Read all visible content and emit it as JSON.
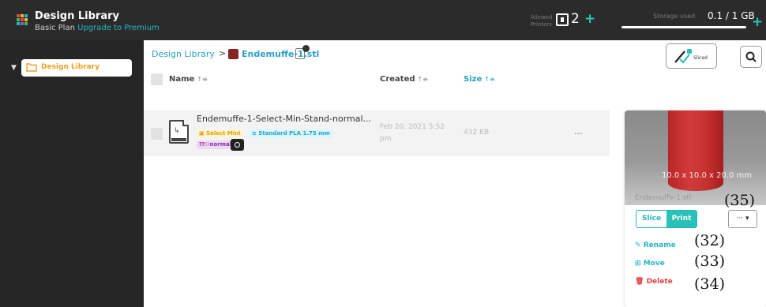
{
  "header": {
    "title": "Design Library",
    "plan": "Basic Plan",
    "upgrade": "Upgrade to Premium",
    "printers_label": "Allowed Printers",
    "printers_count": "2",
    "printers_add": "+",
    "storage_label": "Storage used",
    "storage_value": "0.1 / 1 GB",
    "storage_add": "+"
  },
  "sidebar": {
    "items": [
      {
        "label": "Design Library"
      }
    ]
  },
  "breadcrumb": {
    "root": "Design Library",
    "separator": ">",
    "current": "Endemuffe-1.stl"
  },
  "toolbar": {
    "sliced_label": "Sliced"
  },
  "table": {
    "columns": [
      "Name",
      "Created",
      "Size"
    ],
    "rows": [
      {
        "name": "Endemuffe-1-Select-Min-Stand-normal...",
        "printer_tag": "Select Mini",
        "material_tag": "Standard PLA 1.75 mm",
        "profile_tag": "normal",
        "created": "Feb 20, 2021 5:52 pm",
        "size": "432 KB",
        "more": "..."
      }
    ]
  },
  "preview": {
    "dimensions": "10.0 x 10.0 x 20.0 mm",
    "filename": "Endemuffe-1.stl",
    "slice_label": "Slice",
    "print_label": "Print",
    "more_label": "··· ▾",
    "actions": {
      "rename": "Rename",
      "move": "Move",
      "delete": "Delete"
    }
  },
  "callouts": {
    "c35": "(35)",
    "c32": "(32)",
    "c33": "(33)",
    "c34": "(34)"
  },
  "colors": {
    "accent": "#27b5c6",
    "print": "#2ac2b8",
    "danger": "#e04040",
    "sidebar": "#262626",
    "topbar": "#2b2b2b",
    "folder": "#f0a020"
  }
}
